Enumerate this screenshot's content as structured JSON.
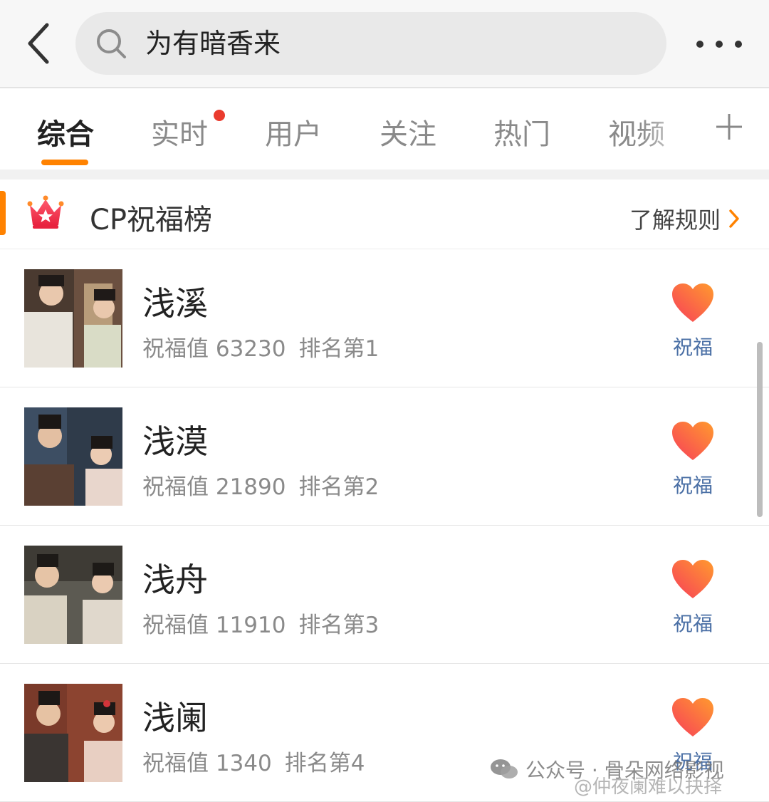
{
  "header": {
    "search_query": "为有暗香来",
    "back_icon": "chevron-left-icon",
    "search_icon": "search-icon",
    "more_icon": "more-dots-icon"
  },
  "tabs": [
    {
      "label": "综合",
      "active": true
    },
    {
      "label": "实时",
      "has_dot": true
    },
    {
      "label": "用户"
    },
    {
      "label": "关注"
    },
    {
      "label": "热门"
    },
    {
      "label": "视频"
    }
  ],
  "tab_add_icon": "plus-icon",
  "cp_board": {
    "title": "CP祝福榜",
    "rules_link": "了解规则",
    "accent_color": "#ff8200"
  },
  "items": [
    {
      "name": "浅溪",
      "value_label": "祝福值 63230",
      "rank_label": "排名第1",
      "bless_label": "祝福"
    },
    {
      "name": "浅漠",
      "value_label": "祝福值 21890",
      "rank_label": "排名第2",
      "bless_label": "祝福"
    },
    {
      "name": "浅舟",
      "value_label": "祝福值 11910",
      "rank_label": "排名第3",
      "bless_label": "祝福"
    },
    {
      "name": "浅阑",
      "value_label": "祝福值 1340",
      "rank_label": "排名第4",
      "bless_label": "祝福"
    }
  ],
  "watermark": {
    "line1": "公众号 · 骨朵网络影视",
    "line2": "@仲夜阑难以抉择"
  },
  "colors": {
    "accent": "#ff8200",
    "link_blue": "#4a6fa5",
    "heart_start": "#f73e5a",
    "heart_end": "#ff9a2e"
  }
}
